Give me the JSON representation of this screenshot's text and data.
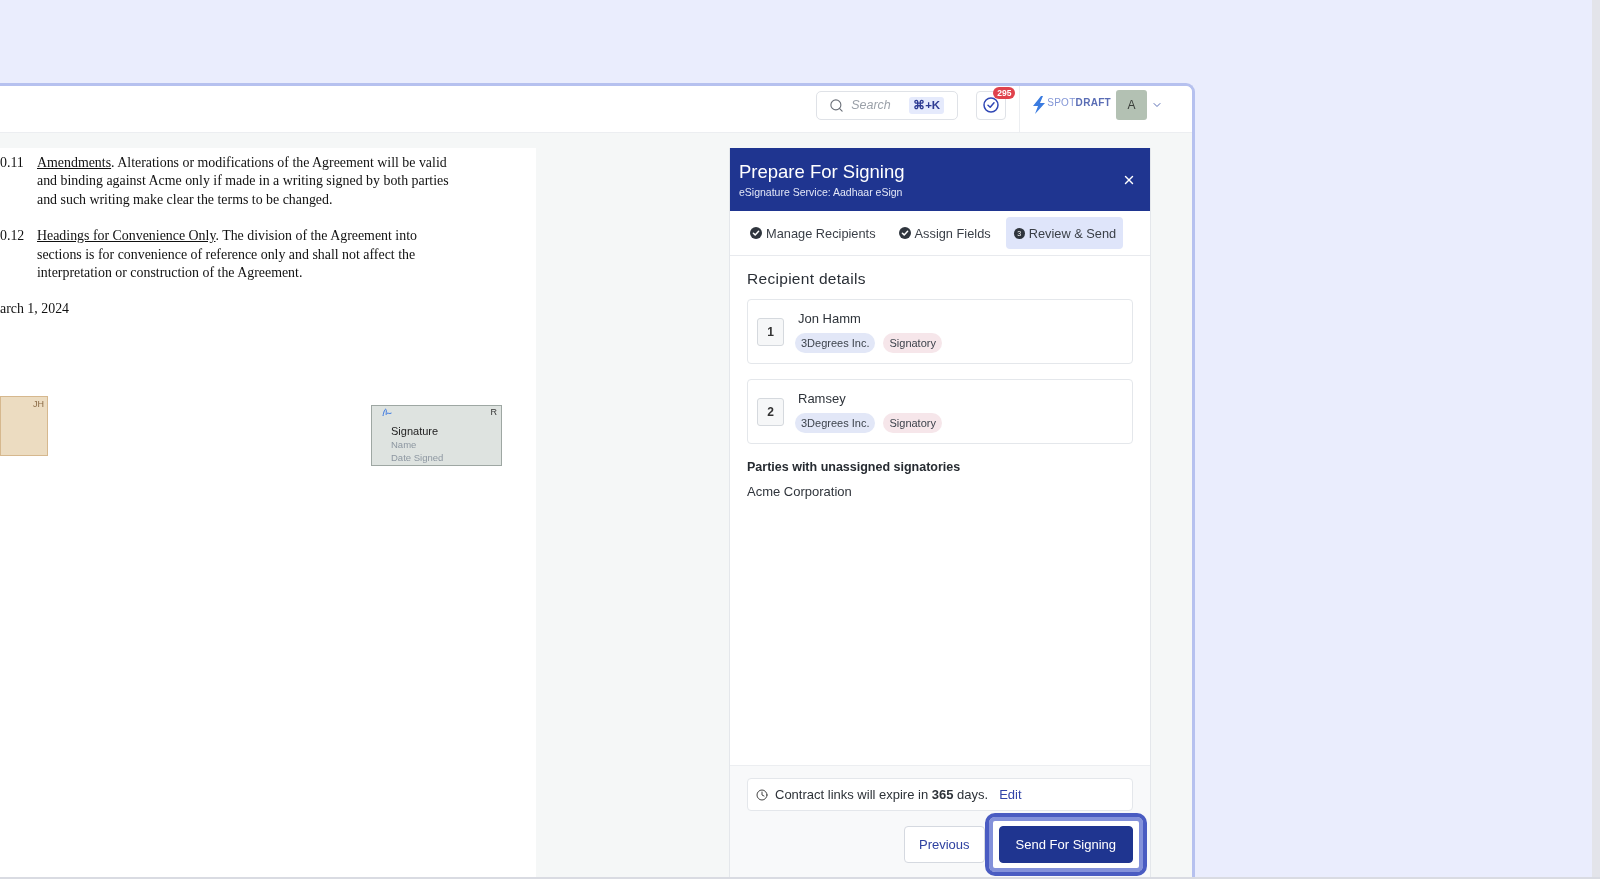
{
  "topbar": {
    "search": {
      "placeholder": "Search",
      "shortcut": "⌘+K"
    },
    "tasks": {
      "badge": "295"
    },
    "brand": "SPOT**DRAFT**",
    "avatar": {
      "initial": "A"
    }
  },
  "document": {
    "clauses": [
      {
        "number": "0.11",
        "heading": "Amendments",
        "lines": [
          ". Alterations or modifications of the Agreement will be valid",
          "and binding against Acme only if made in a writing signed by both parties",
          "and such writing make clear the terms to be changed."
        ]
      },
      {
        "number": "0.12",
        "heading": "Headings for Convenience Only",
        "lines": [
          ". The division of the Agreement into",
          "sections is for convenience of reference only and shall not affect the",
          "interpretation or construction of the Agreement."
        ]
      }
    ],
    "date": "arch 1, 2024",
    "fields": [
      {
        "kind": "blank",
        "initials": "JH",
        "color": "#ecdcc1"
      },
      {
        "kind": "signature",
        "initials": "R",
        "color": "#dee3e0",
        "title": "Signature",
        "details": [
          "Name",
          "Date Signed"
        ]
      }
    ]
  },
  "panel": {
    "title": "Prepare For Signing",
    "subtitle": "eSignature Service: Aadhaar eSign",
    "steps": [
      {
        "label": "Manage Recipients",
        "completed": true,
        "selected": false
      },
      {
        "label": "Assign Fields",
        "completed": true,
        "selected": false
      },
      {
        "label": "Review & Send",
        "completed": false,
        "selected": true,
        "number": "3"
      }
    ],
    "section_title": "Recipient details",
    "recipients": [
      {
        "order": "1",
        "name": "Jon Hamm",
        "tags": [
          {
            "label": "3Degrees Inc.",
            "kind": "party"
          },
          {
            "label": "Signatory",
            "kind": "role"
          }
        ]
      },
      {
        "order": "2",
        "name": "Ramsey",
        "tags": [
          {
            "label": "3Degrees Inc.",
            "kind": "party"
          },
          {
            "label": "Signatory",
            "kind": "role"
          }
        ]
      }
    ],
    "unassigned": {
      "title": "Parties with unassigned signatories",
      "parties": [
        "Acme Corporation"
      ]
    },
    "expiry": {
      "text": "Contract links will expire in **365** days.",
      "action": "Edit"
    },
    "buttons": [
      {
        "label": "Previous",
        "kind": "secondary",
        "focused": false
      },
      {
        "label": "Send For Signing",
        "kind": "primary",
        "focused": true
      }
    ]
  }
}
